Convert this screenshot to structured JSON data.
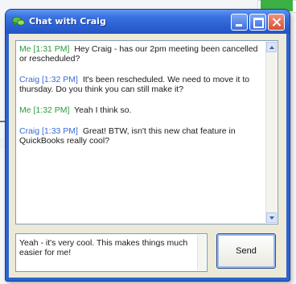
{
  "window": {
    "title": "Chat with Craig"
  },
  "colors": {
    "titlebar": "#2b5fd3",
    "client_bg": "#ece9d8",
    "me_sender": "#2a9a3a",
    "craig_sender": "#3a6ad4",
    "close_button": "#d8502f"
  },
  "icons": {
    "title": "chat-bubbles-icon",
    "minimize": "minimize-icon",
    "maximize": "maximize-icon",
    "close": "close-icon"
  },
  "transcript": {
    "messages": [
      {
        "sender": "Me",
        "time": "[1:31 PM]",
        "text": "Hey Craig - has our 2pm meeting been cancelled or rescheduled?"
      },
      {
        "sender": "Craig",
        "time": "[1:32 PM]",
        "text": "It's been rescheduled.  We need to move it to thursday.  Do you think you can still make it?"
      },
      {
        "sender": "Me",
        "time": "[1:32 PM]",
        "text": "Yeah I think so."
      },
      {
        "sender": "Craig",
        "time": "[1:33 PM]",
        "text": "Great!  BTW, isn't this new chat feature in QuickBooks really cool?"
      }
    ]
  },
  "compose": {
    "value": "Yeah - it's very cool.  This makes things much easier for me!"
  },
  "send_label": "Send"
}
